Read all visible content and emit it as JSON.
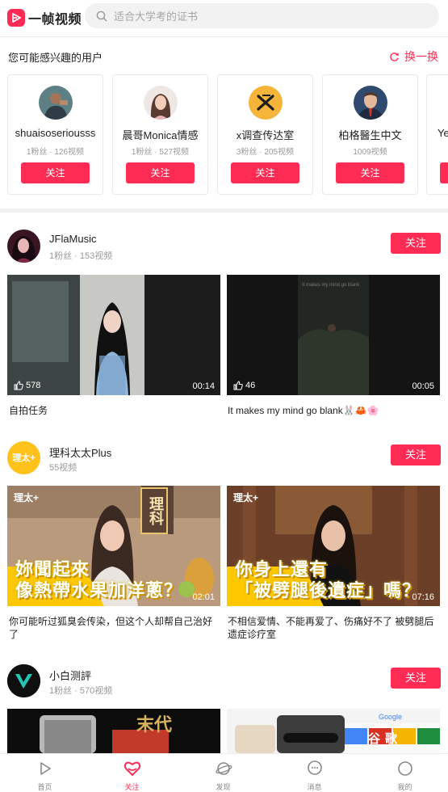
{
  "app": {
    "name": "一帧视频"
  },
  "search": {
    "placeholder": "适合大学考的证书"
  },
  "recommend": {
    "title": "您可能感兴趣的用户",
    "refresh_label": "换一换",
    "users": [
      {
        "name": "shuaisoseriousss",
        "meta": "1粉丝 · 126视频",
        "follow": "关注"
      },
      {
        "name": "晨哥Monica情感",
        "meta": "1粉丝 · 527视频",
        "follow": "关注"
      },
      {
        "name": "x调查传达室",
        "meta": "3粉丝 · 205视频",
        "follow": "关注"
      },
      {
        "name": "柏格醫生中文",
        "meta": "1009视频",
        "follow": "关注"
      },
      {
        "name": "Ye",
        "meta": "",
        "follow": "关注"
      }
    ]
  },
  "feed": [
    {
      "author": "JFlaMusic",
      "meta": "1粉丝 · 153视频",
      "follow": "关注",
      "videos": [
        {
          "likes": "578",
          "duration": "00:14",
          "title": "自拍任务"
        },
        {
          "likes": "46",
          "duration": "00:05",
          "title": "It makes my mind go blank🐰🦀🌸",
          "overlay": "It makes my mind go blank"
        }
      ]
    },
    {
      "author": "理科太太Plus",
      "meta": "55视频",
      "follow": "关注",
      "avatar_text": "理太+",
      "videos": [
        {
          "likes": "",
          "duration": "02:01",
          "title": "你可能听过狐臭会传染，但这个人却帮自己治好了",
          "brand": "理太+",
          "sign": "理科",
          "caption1": "妳聞起來",
          "caption2": "像熱帶水果加洋蔥？"
        },
        {
          "likes": "",
          "duration": "07:16",
          "title": "不相信爱情、不能再爱了、伤痛好不了 被劈腿后遗症诊疗室",
          "brand": "理太+",
          "caption1": "你身上還有",
          "caption2": "「被劈腿後遺症」嗎？"
        }
      ]
    },
    {
      "author": "小白测評",
      "meta": "1粉丝 · 570视频",
      "follow": "关注",
      "videos": [
        {
          "title": "",
          "caption1": "末代"
        },
        {
          "title": "",
          "brand": "Google",
          "caption1": "谷歌"
        }
      ]
    }
  ],
  "bottom_nav": [
    {
      "label": "首页",
      "icon": "play-icon"
    },
    {
      "label": "关注",
      "icon": "heart-icon",
      "active": true
    },
    {
      "label": "发现",
      "icon": "planet-icon"
    },
    {
      "label": "消息",
      "icon": "message-icon"
    },
    {
      "label": "我的",
      "icon": "profile-icon"
    }
  ],
  "colors": {
    "accent": "#fe2c55",
    "caption_yellow": "#ffc800"
  }
}
